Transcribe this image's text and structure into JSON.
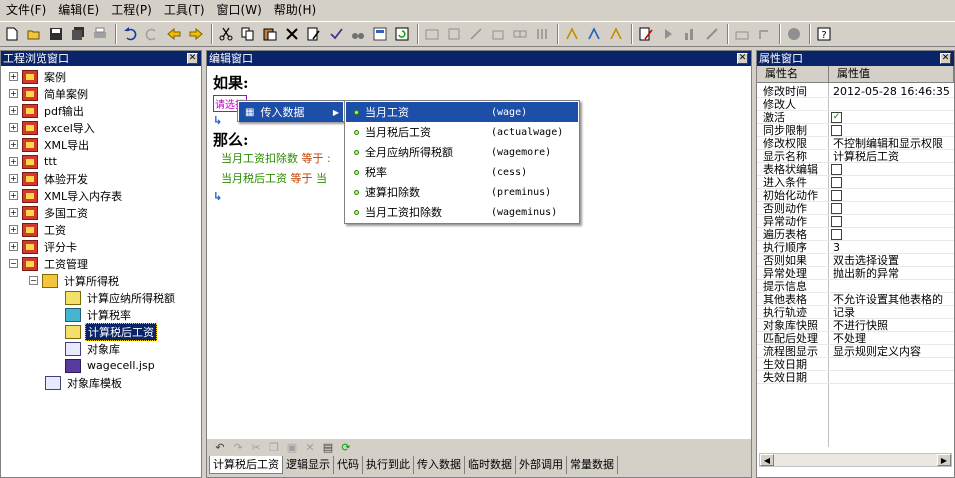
{
  "menu": [
    "文件(F)",
    "编辑(E)",
    "工程(P)",
    "工具(T)",
    "窗口(W)",
    "帮助(H)"
  ],
  "toolbar_icons": [
    "new-icon",
    "open-icon",
    "save-icon",
    "save-all-icon",
    "print-icon",
    "undo-icon",
    "redo-icon",
    "back-icon",
    "forward-icon",
    "cut-icon",
    "copy-icon",
    "paste-icon",
    "delete-icon",
    "edit-icon",
    "check-icon",
    "find-icon",
    "properties-icon",
    "refresh-icon",
    "project-icon",
    "module-icon",
    "export-icon",
    "import-icon",
    "link-icon",
    "table-icon",
    "debug-icon",
    "debug2-icon",
    "debug3-icon",
    "edit-doc-icon",
    "run-icon",
    "chart-icon",
    "chart2-icon",
    "publish-icon",
    "deploy-icon",
    "db-icon",
    "help-icon"
  ],
  "left_panel": {
    "title": "工程浏览窗口",
    "items": [
      {
        "label": "案例",
        "expander": "+"
      },
      {
        "label": "简单案例",
        "expander": "+"
      },
      {
        "label": "pdf输出",
        "expander": "+"
      },
      {
        "label": "excel导入",
        "expander": "+"
      },
      {
        "label": "XML导出",
        "expander": "+"
      },
      {
        "label": "ttt",
        "expander": "+"
      },
      {
        "label": "体验开发",
        "expander": "+"
      },
      {
        "label": "XML导入内存表",
        "expander": "+"
      },
      {
        "label": "多国工资",
        "expander": "+"
      },
      {
        "label": "工资",
        "expander": "+"
      },
      {
        "label": "评分卡",
        "expander": "+"
      },
      {
        "label": "工资管理",
        "expander": "−"
      },
      {
        "label": "计算所得税",
        "expander": "−"
      },
      {
        "label": "计算应纳所得税额",
        "expander": ""
      },
      {
        "label": "计算税率",
        "expander": ""
      },
      {
        "label": "计算税后工资",
        "expander": ""
      },
      {
        "label": "对象库",
        "expander": ""
      },
      {
        "label": "wagecell.jsp",
        "expander": ""
      },
      {
        "label": "对象库模板",
        "expander": ""
      }
    ]
  },
  "editor": {
    "title": "编辑窗口",
    "if_label": "如果:",
    "pick_label": "请选择",
    "then_label": "那么:",
    "stmt1_a": "当月工资扣除数",
    "stmt1_k": "等于",
    "stmt1_b": ":",
    "stmt2_a": "当月税后工资",
    "stmt2_k": "等于",
    "stmt2_b": "当",
    "context_menu": {
      "item": "传入数据",
      "arrow": "▶"
    },
    "submenu": [
      {
        "label": "当月工资",
        "code": "(wage)"
      },
      {
        "label": "当月税后工资",
        "code": "(actualwage)"
      },
      {
        "label": "全月应纳所得税额",
        "code": "(wagemore)"
      },
      {
        "label": "税率",
        "code": "(cess)"
      },
      {
        "label": "速算扣除数",
        "code": "(preminus)"
      },
      {
        "label": "当月工资扣除数",
        "code": "(wageminus)"
      }
    ],
    "tabs": [
      "计算税后工资",
      "逻辑显示",
      "代码",
      "执行到此",
      "传入数据",
      "临时数据",
      "外部调用",
      "常量数据"
    ]
  },
  "properties": {
    "title": "属性窗口",
    "col_name": "属性名",
    "col_value": "属性值",
    "rows": [
      {
        "name": "修改时间",
        "value": "2012-05-28 16:46:35"
      },
      {
        "name": "修改人",
        "value": ""
      },
      {
        "name": "激活",
        "value": "",
        "check": "✓"
      },
      {
        "name": "同步限制",
        "value": "",
        "check": ""
      },
      {
        "name": "修改权限",
        "value": "不控制编辑和显示权限"
      },
      {
        "name": "显示名称",
        "value": "计算税后工资"
      },
      {
        "name": "表格状编辑",
        "value": "",
        "check": ""
      },
      {
        "name": "进入条件",
        "value": "",
        "check": ""
      },
      {
        "name": "初始化动作",
        "value": "",
        "check": ""
      },
      {
        "name": "否则动作",
        "value": "",
        "check": ""
      },
      {
        "name": "异常动作",
        "value": "",
        "check": ""
      },
      {
        "name": "遍历表格",
        "value": "",
        "check": ""
      },
      {
        "name": "执行顺序",
        "value": "3"
      },
      {
        "name": "否则如果",
        "value": "双击选择设置"
      },
      {
        "name": "异常处理",
        "value": "抛出新的异常"
      },
      {
        "name": "提示信息",
        "value": ""
      },
      {
        "name": "其他表格",
        "value": "不允许设置其他表格的"
      },
      {
        "name": "执行轨迹",
        "value": "记录"
      },
      {
        "name": "对象库快照",
        "value": "不进行快照"
      },
      {
        "name": "匹配后处理",
        "value": "不处理"
      },
      {
        "name": "流程图显示",
        "value": "显示规则定义内容"
      },
      {
        "name": "生效日期",
        "value": ""
      },
      {
        "name": "失效日期",
        "value": ""
      }
    ]
  },
  "colors": {
    "title_bar": "#0a246a",
    "selection": "#1e4fa8",
    "action_green": "#2a8c00",
    "keyword": "#c04000"
  }
}
